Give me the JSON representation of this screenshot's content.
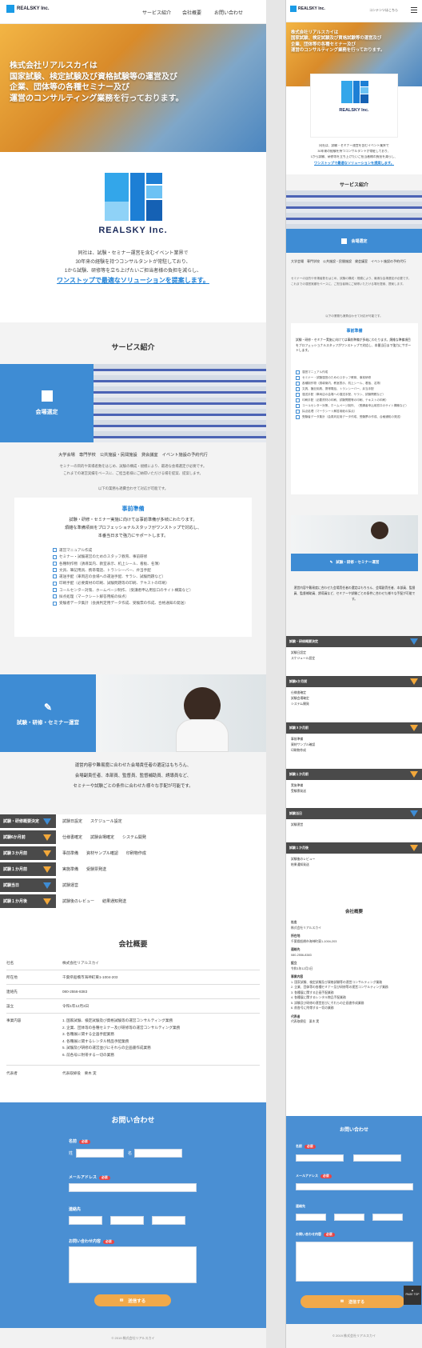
{
  "brand": {
    "name": "REALSKY Inc.",
    "tagline": "リアルスカイ"
  },
  "nav": {
    "service": "サービス紹介",
    "company": "会社概要",
    "contact": "お問い合わせ",
    "sp_menu": "コンテンツはこちら"
  },
  "hero": {
    "line1": "株式会社リアルスカイは",
    "line2": "国家試験、検定試験及び資格試験等の運営及び",
    "line3": "企業、団体等の各種セミナー及び",
    "line4": "運営のコンサルティング業務を行っております。",
    "sp_lines": [
      "株式会社リアルスカイは",
      "国家試験、検定試験及び資格試験等の運営及び",
      "企業、団体等の各種セミナー及び",
      "運営のコンサルティング業務を行っております。"
    ]
  },
  "intro": {
    "p1": "同社は、試験・セミナー運営を含むイベント業界で",
    "p2": "30年来の経験を持つコンサルタントが常駐しており、",
    "p3": "1から試験、研修等を立ち上げたいご担当者様の負担を減らし、",
    "highlight": "ワンストップで最適なソリューションを提案します。"
  },
  "services": {
    "heading": "サービス紹介",
    "venue": {
      "label": "会場選定",
      "places": "大学会場　専門学校　公共施設・民間施設　貸会議室　イベント施設の予約代行",
      "desc1": "セミナーの目的や来場者数をはじめ、試験の構成・規模により、最適な会場選定が必要です。",
      "desc2": "これまでの運営実績をベースに、ご担当者様にご納得いただける場を提案、提案します。",
      "note": "以下の業務も適費合わせて対応が可能です。"
    },
    "prep": {
      "title": "事前準備",
      "desc1": "試験・研修・セミナー実施に向けては事前準備が多岐にわたります。",
      "desc2": "煩雑な準備項目をプロフェッショナルスタッフがワンストップで対応し、",
      "desc3": "本番当日まで強力にサポートします。",
      "items": [
        "運営マニュアル作成",
        "セミナー・試験運営のためのスタッフ教育、事前研修",
        "各種制作物（誘導案内、教室表示、机上シール、看板、名簿）",
        "文具、筆記用具、携帯電話、トランシーバー、弁当手配",
        "運送手配（車両店の会場への運送手配、サラシ、試験問題など）",
        "印刷手配（必要資材の印刷、試験問題等の印刷、テキストの印刷）",
        "コールセンター対策、ホームページ制作、（受講者申込用窓口のサイト構築など）",
        "採点処理（マークシート解答用紙の採点）",
        "受験者データ集計（会員判定用データ作成、受験票の作成、合格通知の発送）"
      ]
    },
    "exam": {
      "label": "試験・研修・セミナー運営",
      "desc1": "運営内容や難易度に合わせた会場責任者の選定はもちろん、",
      "desc2": "会場副責任者、本部員、監督員、監督補助員、誘導員など、",
      "desc3": "セミナーや試験ごとの条件に合わせた様々な手配が可能です。"
    },
    "schedule": [
      {
        "label": "試験・研修概要決定",
        "items": [
          "試験日設定",
          "スケジュール設定"
        ]
      },
      {
        "label": "試験6か月前",
        "items": [
          "仕様書確定",
          "試験会場確定",
          "システム開発"
        ]
      },
      {
        "label": "試験３か月前",
        "items": [
          "事前準備",
          "資材サンプル確認",
          "印刷物作成"
        ]
      },
      {
        "label": "試験１か月前",
        "items": [
          "実施準備",
          "受験票発送"
        ]
      },
      {
        "label": "試験当日",
        "items": [
          "試験運営"
        ]
      },
      {
        "label": "試験１か月後",
        "items": [
          "試験後のレビュー",
          "結果通知発送"
        ]
      }
    ]
  },
  "company": {
    "heading": "会社概要",
    "rows": [
      {
        "key": "社名",
        "value": "株式会社リアルスカイ"
      },
      {
        "key": "所在地",
        "value": "千葉県船橋市海神町東1-1004-203"
      },
      {
        "key": "連絡先",
        "value": "080-2556-8383"
      },
      {
        "key": "設立",
        "value": "令和1年12月3日"
      },
      {
        "key": "事業内容",
        "value": "1. 国家試験、検定試験及び資格試験等の運営コンサルティング業務"
      },
      {
        "key": "代表者",
        "value": "代表取締役　栗木 実"
      }
    ],
    "business": [
      "1. 国家試験、検定試験及び資格試験等の運営コンサルティング業務",
      "2. 企業、団体等の各種セミナー及び研修等の運営コンサルティング業務",
      "3. 各種展に関する企画手配業務",
      "4. 各種展に関するレンタル物品手配業務",
      "5. 試験及び研修の運営並びにそれらの企画書作成業務",
      "6. 前各号に附帯する一切の業務"
    ]
  },
  "contact": {
    "heading": "お問い合わせ",
    "name_label": "名前",
    "required": "必須",
    "sei": "姓",
    "mei": "名",
    "email_label": "メールアドレス",
    "tel_label": "連絡先",
    "body_label": "お問い合わせ内容",
    "send": "送信する"
  },
  "footer": {
    "copyright": "© 2019 株式会社リアルスカイ"
  },
  "pagetop": "PAGE TOP",
  "colors": {
    "accent": "#3e8cd4",
    "dark": "#4a4a4a",
    "orange": "#f1a94a",
    "logo": "#1a9be6"
  }
}
